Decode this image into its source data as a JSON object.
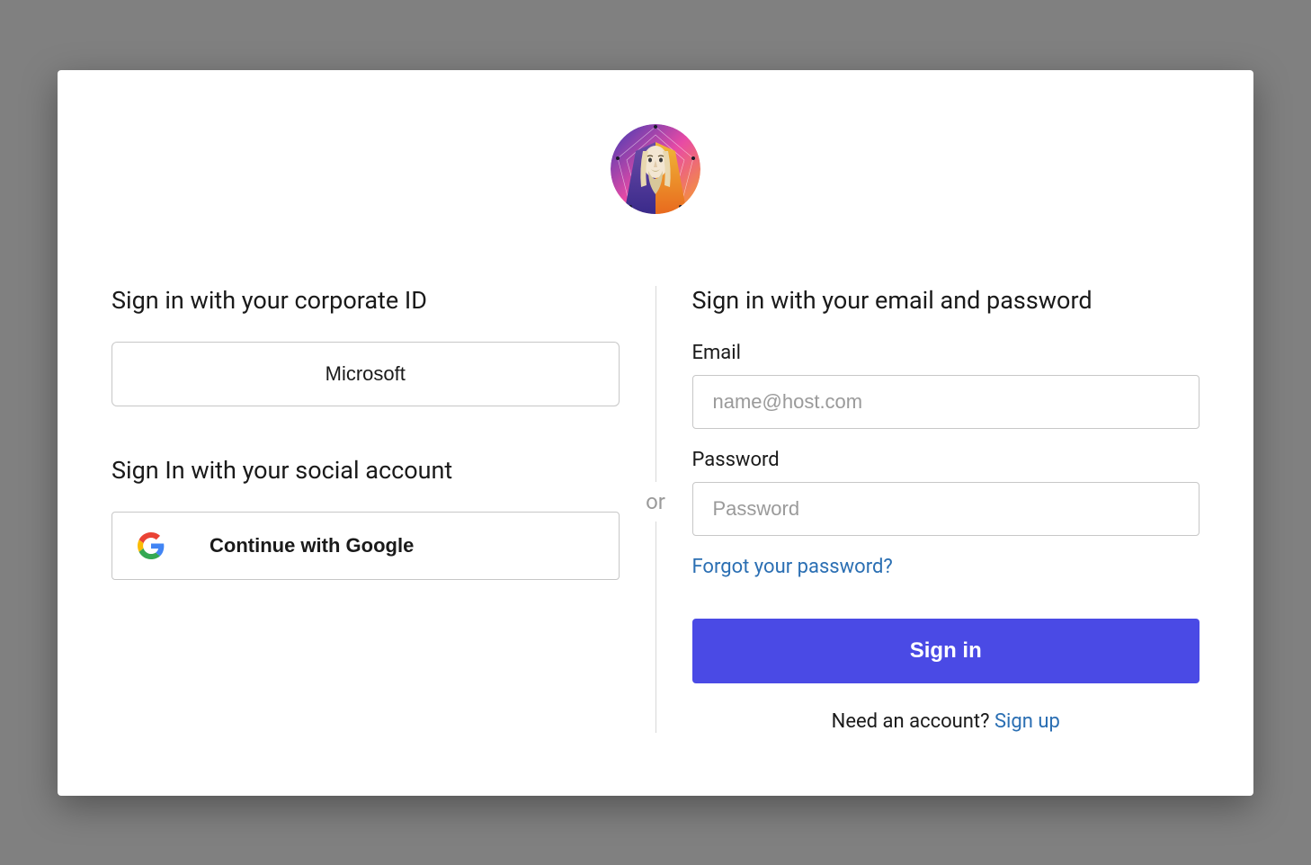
{
  "left": {
    "corporate_heading": "Sign in with your corporate ID",
    "microsoft_label": "Microsoft",
    "social_heading": "Sign In with your social account",
    "google_label": "Continue with Google"
  },
  "divider": {
    "or_text": "or"
  },
  "right": {
    "heading": "Sign in with your email and password",
    "email_label": "Email",
    "email_placeholder": "name@host.com",
    "password_label": "Password",
    "password_placeholder": "Password",
    "forgot_text": "Forgot your password?",
    "signin_button": "Sign in",
    "signup_prefix": "Need an account? ",
    "signup_link": "Sign up"
  }
}
